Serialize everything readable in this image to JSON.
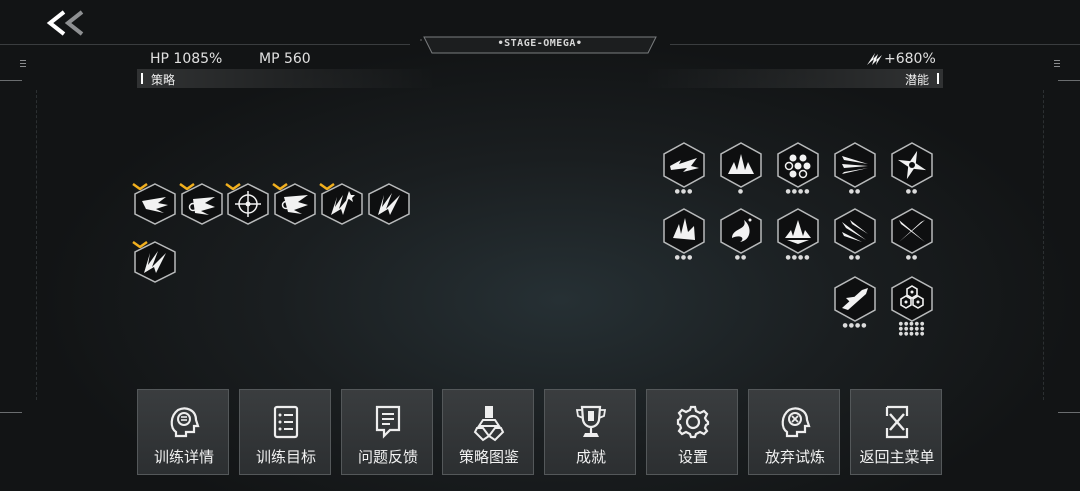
{
  "header": {
    "stage_title": "•STAGE-OMEGA•",
    "hp": "HP 1085%",
    "mp": "MP 560",
    "potential_bonus": "+680%"
  },
  "sections": {
    "strategy_label": "策略",
    "potential_label": "潜能"
  },
  "strategy_skills": [
    {
      "icon": "wind-slash-icon",
      "selected": true
    },
    {
      "icon": "swirl-slash-icon",
      "selected": true
    },
    {
      "icon": "crosshair-icon",
      "selected": true
    },
    {
      "icon": "swirl-slash-icon",
      "selected": true
    },
    {
      "icon": "claw-spark-icon",
      "selected": true
    },
    {
      "icon": "claw-icon",
      "selected": false
    },
    {
      "icon": "claw-icon",
      "selected": true
    }
  ],
  "potential_skills": [
    {
      "icon": "dash-wind-icon",
      "level": "●●●"
    },
    {
      "icon": "crystal-burst-icon",
      "level": "●"
    },
    {
      "icon": "flower-burst-icon",
      "level": "●●●●"
    },
    {
      "icon": "triple-slash-icon",
      "level": "●●"
    },
    {
      "icon": "shuriken-icon",
      "level": "●●"
    },
    {
      "icon": "crystal-cluster-icon",
      "level": "●●●"
    },
    {
      "icon": "splash-icon",
      "level": "●●"
    },
    {
      "icon": "lotus-icon",
      "level": "●●●●"
    },
    {
      "icon": "feather-slash-icon",
      "level": "●●"
    },
    {
      "icon": "cross-slash-icon",
      "level": "●●"
    },
    {
      "icon": "sword-slash-icon",
      "level": "●●●●"
    },
    {
      "icon": "hex-cluster-icon",
      "level": "●●●●●\n●●●●●\n●●●●●"
    }
  ],
  "menu": [
    {
      "label": "训练详情",
      "icon": "training-details-icon"
    },
    {
      "label": "训练目标",
      "icon": "training-goals-icon"
    },
    {
      "label": "问题反馈",
      "icon": "feedback-icon"
    },
    {
      "label": "策略图鉴",
      "icon": "strategy-codex-icon"
    },
    {
      "label": "成就",
      "icon": "trophy-icon"
    },
    {
      "label": "设置",
      "icon": "gear-icon"
    },
    {
      "label": "放弃试炼",
      "icon": "abandon-trial-icon"
    },
    {
      "label": "返回主菜单",
      "icon": "main-menu-icon"
    }
  ],
  "colors": {
    "accent": "#f2b01e",
    "panel": "#333638",
    "icon_bg": "#0e0f10"
  }
}
